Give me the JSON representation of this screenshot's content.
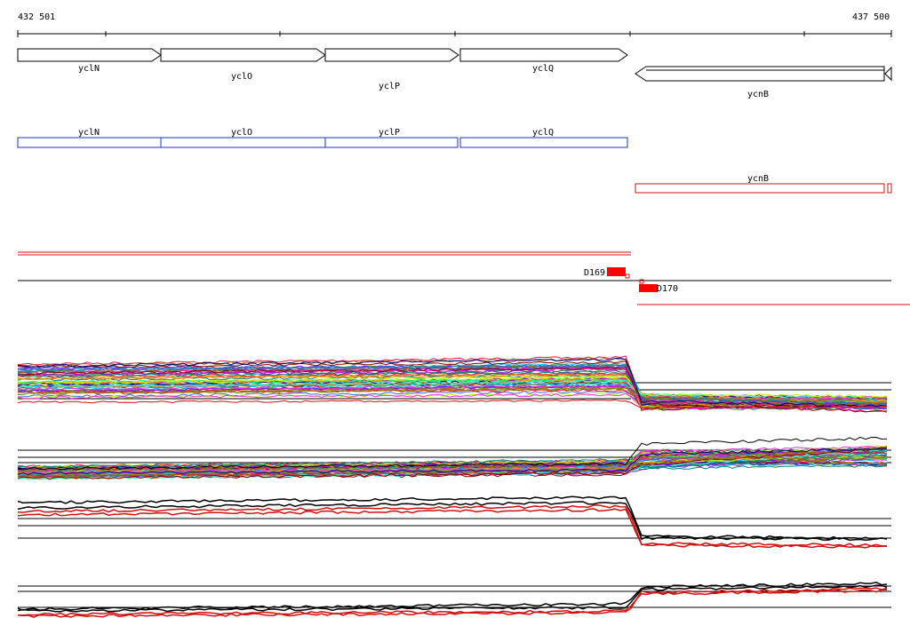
{
  "scale": {
    "start_label": "432 501",
    "end_label": "437 500"
  },
  "genes_forward": [
    {
      "name": "yclN"
    },
    {
      "name": "yclO"
    },
    {
      "name": "yclP"
    },
    {
      "name": "yclQ"
    }
  ],
  "genes_reverse": [
    {
      "name": "ycnB"
    }
  ],
  "cds_forward": [
    {
      "name": "yclN"
    },
    {
      "name": "yclO"
    },
    {
      "name": "yclP"
    },
    {
      "name": "yclQ"
    }
  ],
  "cds_reverse": [
    {
      "name": "ycnB"
    }
  ],
  "probes": [
    {
      "name": "D169"
    },
    {
      "name": "D170"
    }
  ],
  "colors": {
    "gene": "#000000",
    "cds_forward": "#1f2fd0",
    "cds_reverse": "#d01010",
    "probe": "#ff0000",
    "axis": "#000000"
  }
}
